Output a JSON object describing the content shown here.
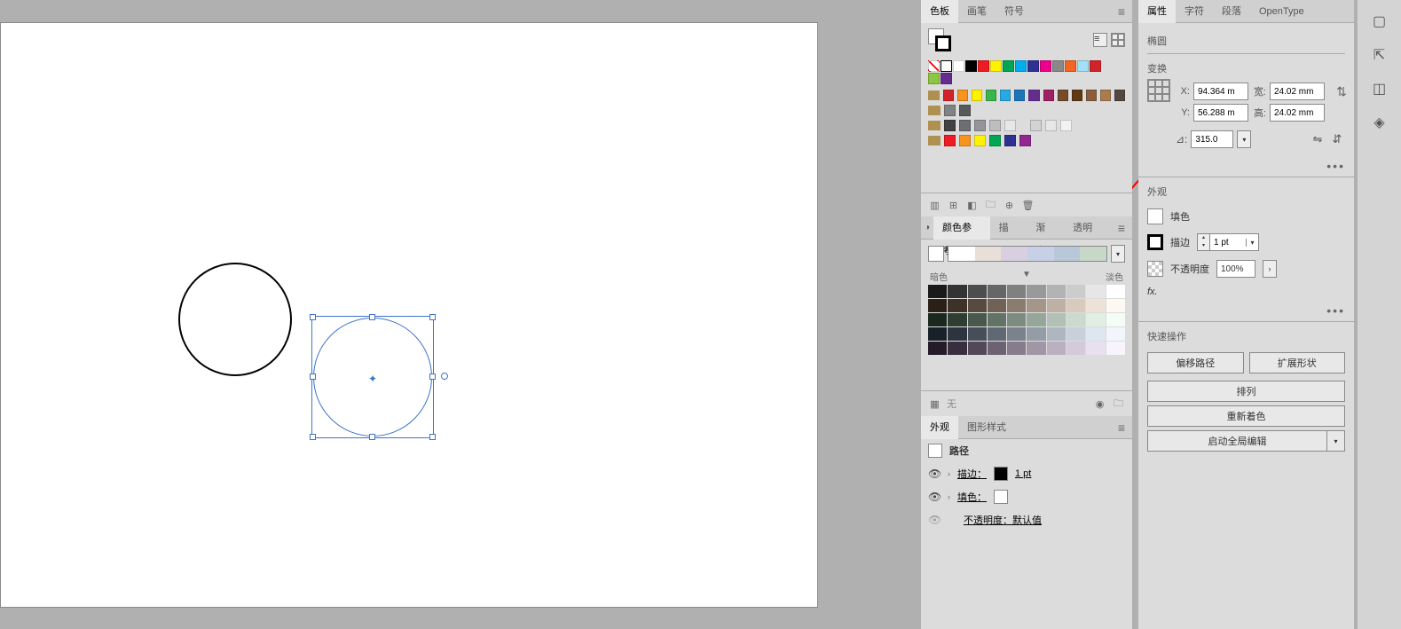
{
  "mid_tabs": {
    "swatches": "色板",
    "brushes": "画笔",
    "symbols": "符号"
  },
  "color_guide": {
    "tab": "颜色参考",
    "stroke": "描边",
    "gradient": "渐变",
    "transparency": "透明度",
    "dark": "暗色",
    "light": "淡色",
    "none": "无"
  },
  "appearance": {
    "tab": "外观",
    "styles": "图形样式",
    "path": "路径",
    "stroke": "描边：",
    "stroke_val": "1 pt",
    "fill": "填色：",
    "opacity": "不透明度：默认值"
  },
  "right_tabs": {
    "properties": "属性",
    "character": "字符",
    "paragraph": "段落",
    "opentype": "OpenType"
  },
  "properties": {
    "shape": "椭圆",
    "transform": "变换",
    "x_label": "X:",
    "x": "94.364 m",
    "y_label": "Y:",
    "y": "56.288 m",
    "w_label": "宽:",
    "w": "24.02 mm",
    "h_label": "高:",
    "h": "24.02 mm",
    "angle_label": "⊿:",
    "angle": "315.0",
    "appearance_label": "外观",
    "fill": "填色",
    "stroke": "描边",
    "stroke_val": "1 pt",
    "opacity": "不透明度",
    "opacity_val": "100%",
    "fx": "fx.",
    "quick_actions": "快速操作",
    "offset_path": "偏移路径",
    "expand_shape": "扩展形状",
    "arrange": "排列",
    "recolor": "重新着色",
    "global_edit": "启动全局编辑"
  }
}
